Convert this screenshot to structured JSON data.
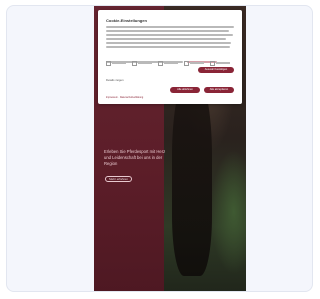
{
  "modal": {
    "title": "Cookie-Einstellungen",
    "accept_selected_label": "Auswahl bestätigen",
    "details_label": "Details zeigen",
    "deny_label": "Alle ablehnen",
    "accept_all_label": "Alle akzeptieren",
    "imprint_label": "Impressum · Datenschutzerklärung",
    "checkbox_count": 5
  },
  "hero": {
    "text": "Erleben Sie Pferdesport mit Herz und Leidenschaft bei uns in der Region",
    "button_label": "Mehr erfahren"
  },
  "colors": {
    "brand": "#8a2537",
    "background": "#5a1e28"
  }
}
